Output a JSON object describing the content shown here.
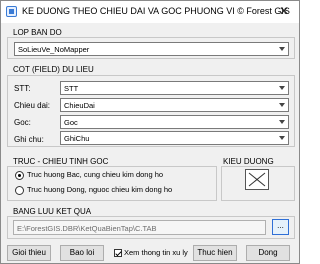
{
  "window": {
    "title": "KE DUONG THEO CHIEU DAI VA GOC PHUONG VI © Forest GIS",
    "close_symbol": "✕"
  },
  "lop_ban_do": {
    "label": "LOP BAN DO",
    "value": "SoLieuVe_NoMapper"
  },
  "cot_du_lieu": {
    "label": "COT (FIELD) DU LIEU",
    "fields": [
      {
        "label": "STT:",
        "value": "STT"
      },
      {
        "label": "Chieu dai:",
        "value": "ChieuDai"
      },
      {
        "label": "Goc:",
        "value": "Goc"
      },
      {
        "label": "Ghi chu:",
        "value": "GhiChu"
      }
    ]
  },
  "truc_chieu": {
    "label": "TRUC - CHIEU TINH GOC",
    "options": [
      {
        "label": "Truc huong Bac, cung chieu kim dong ho",
        "selected": true
      },
      {
        "label": "Truc huong Dong, nguoc chieu kim dong ho",
        "selected": false
      }
    ]
  },
  "kieu_duong": {
    "label": "KIEU DUONG",
    "icon": "line-style-icon"
  },
  "bang_luu": {
    "label": "BANG LUU KET QUA",
    "path": "E:\\ForestGIS.DBR\\KetQuaBienTap\\C.TAB",
    "browse_label": "..."
  },
  "footer": {
    "checkbox_label": "Xem thong tin xu ly",
    "checkbox_checked": true,
    "buttons": {
      "gioi_thieu": "Gioi thieu",
      "bao_loi": "Bao loi",
      "thuc_hien": "Thuc hien",
      "dong": "Dong"
    }
  }
}
